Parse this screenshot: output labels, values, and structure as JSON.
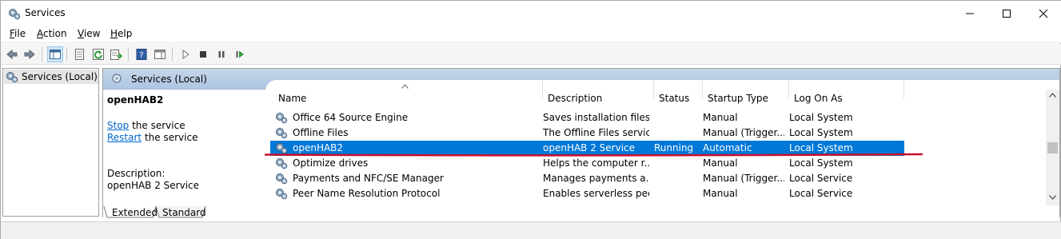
{
  "window": {
    "title": "Services",
    "controls": {
      "minimize": "minimize",
      "maximize": "maximize",
      "close": "close"
    }
  },
  "menu": {
    "file": {
      "u": "F",
      "rest": "ile"
    },
    "action": {
      "u": "A",
      "rest": "ction"
    },
    "view": {
      "u": "V",
      "rest": "iew"
    },
    "help": {
      "u": "H",
      "rest": "elp"
    }
  },
  "tree": {
    "item_label": "Services (Local)"
  },
  "pane": {
    "header_label": "Services (Local)"
  },
  "detail": {
    "service_name": "openHAB2",
    "stop_link": "Stop",
    "stop_rest": " the service",
    "restart_link": "Restart",
    "restart_rest": " the service",
    "description_label": "Description:",
    "description_text": "openHAB 2 Service"
  },
  "table": {
    "columns": [
      "Name",
      "Description",
      "Status",
      "Startup Type",
      "Log On As"
    ],
    "rows": [
      {
        "name": "Office 64 Source Engine",
        "description": "Saves installation files ...",
        "status": "",
        "startup": "Manual",
        "logon": "Local System",
        "selected": false
      },
      {
        "name": "Offline Files",
        "description": "The Offline Files servic...",
        "status": "",
        "startup": "Manual (Trigger...",
        "logon": "Local System",
        "selected": false
      },
      {
        "name": "openHAB2",
        "description": "openHAB 2 Service",
        "status": "Running",
        "startup": "Automatic",
        "logon": "Local System",
        "selected": true
      },
      {
        "name": "Optimize drives",
        "description": "Helps the computer r...",
        "status": "",
        "startup": "Manual",
        "logon": "Local System",
        "selected": false
      },
      {
        "name": "Payments and NFC/SE Manager",
        "description": "Manages payments a...",
        "status": "",
        "startup": "Manual (Trigger...",
        "logon": "Local Service",
        "selected": false
      },
      {
        "name": "Peer Name Resolution Protocol",
        "description": "Enables serverless pee...",
        "status": "",
        "startup": "Manual",
        "logon": "Local Service",
        "selected": false
      }
    ]
  },
  "tabs": {
    "extended": "Extended",
    "standard": "Standard"
  },
  "colors": {
    "selection": "#0078d7",
    "header_band": "#b6cce6",
    "link": "#0066cc",
    "annotation": "#c8102e"
  }
}
